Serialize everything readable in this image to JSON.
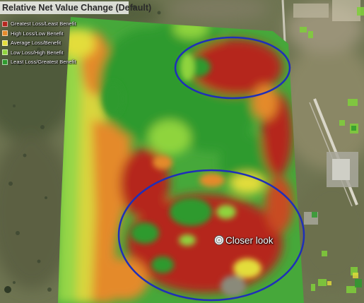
{
  "legend": {
    "title": "Relative Net Value Change (Default)",
    "items": [
      {
        "label": "Greatest Loss/Least Benefit",
        "color": "#b5271e"
      },
      {
        "label": "High Loss/Low Benefit",
        "color": "#e48a2a"
      },
      {
        "label": "Average Loss/Benefit",
        "color": "#e3dd3a"
      },
      {
        "label": "Low Loss/High Benefit",
        "color": "#8fd43c"
      },
      {
        "label": "Least Loss/Greatest Benefit",
        "color": "#2f9a2e"
      }
    ]
  },
  "placemark": {
    "label": "Closer look",
    "icon": "placemark-circle-icon"
  },
  "annotations": {
    "color": "#1f2fb8",
    "shape": "ellipse",
    "count": 2
  }
}
